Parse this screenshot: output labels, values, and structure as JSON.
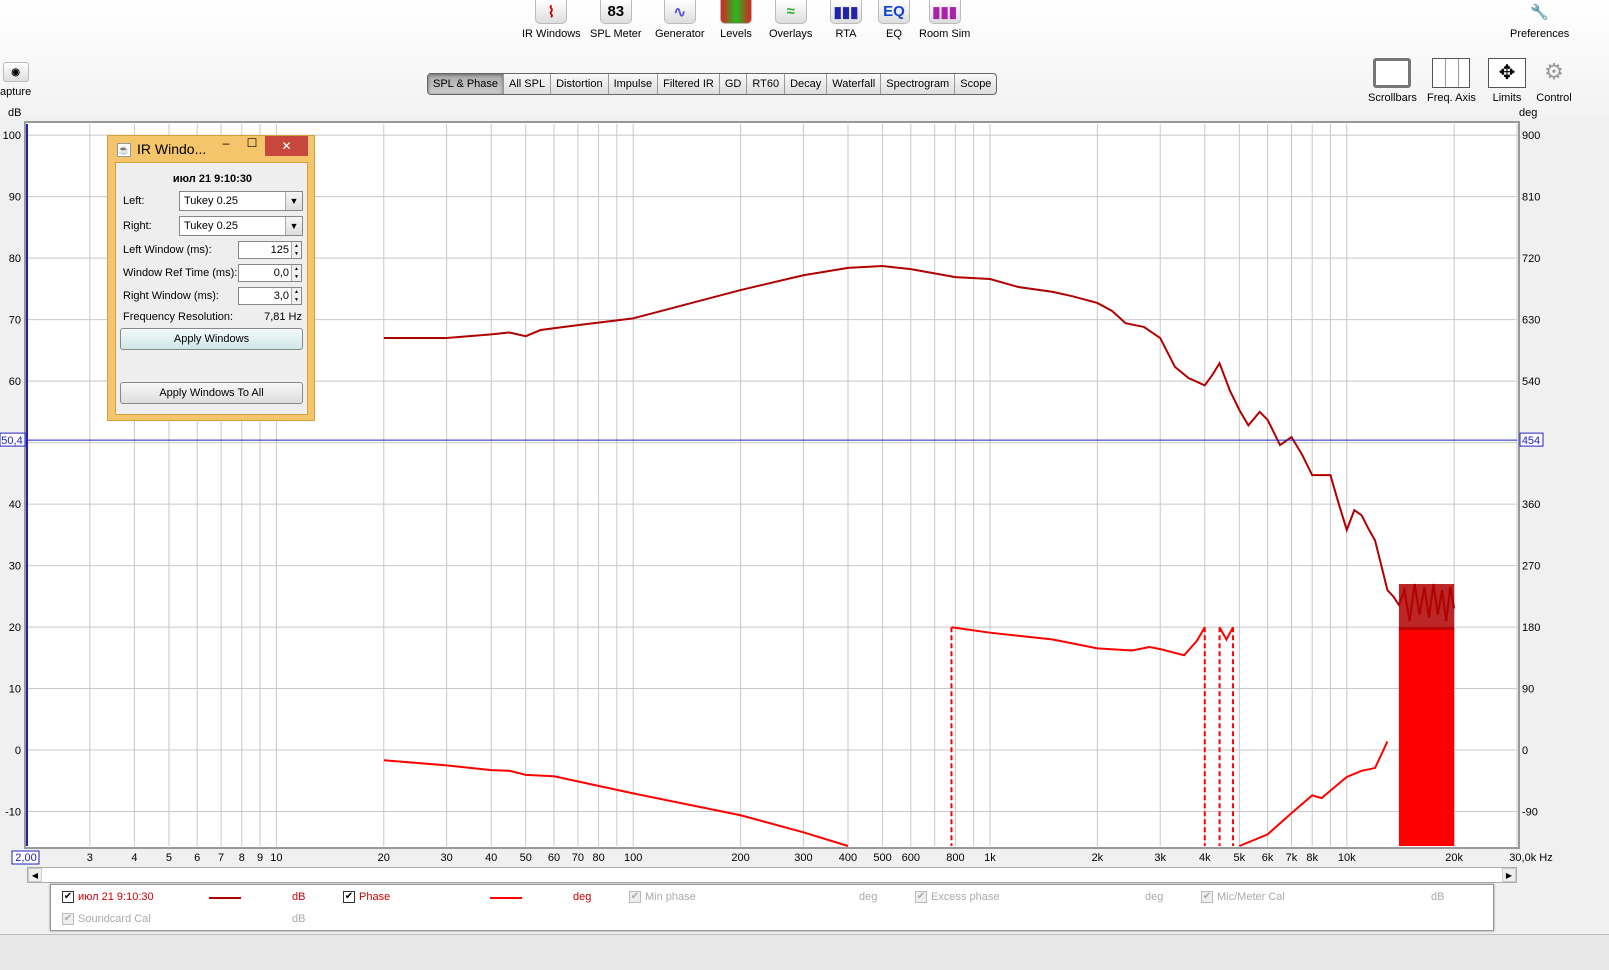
{
  "toolbar": {
    "tools": [
      {
        "label": "IR Windows",
        "icon": "ir-windows-icon"
      },
      {
        "label": "SPL Meter",
        "icon": "spl-meter-icon",
        "value": "83"
      },
      {
        "label": "Generator",
        "icon": "generator-icon"
      },
      {
        "label": "Levels",
        "icon": "levels-icon"
      },
      {
        "label": "Overlays",
        "icon": "overlays-icon"
      },
      {
        "label": "RTA",
        "icon": "rta-icon"
      },
      {
        "label": "EQ",
        "icon": "eq-icon",
        "value": "EQ"
      },
      {
        "label": "Room Sim",
        "icon": "room-sim-icon"
      }
    ],
    "preferences": "Preferences",
    "capture": "apture"
  },
  "tabs": [
    "SPL & Phase",
    "All SPL",
    "Distortion",
    "Impulse",
    "Filtered IR",
    "GD",
    "RT60",
    "Decay",
    "Waterfall",
    "Spectrogram",
    "Scope"
  ],
  "active_tab": "SPL & Phase",
  "right_tools": [
    "Scrollbars",
    "Freq. Axis",
    "Limits",
    "Control"
  ],
  "colors": {
    "spl": "#b00000",
    "phase": "#ff0000",
    "cursor": "#2020c0",
    "grid": "#c8c8c8"
  },
  "chart_data": {
    "type": "line",
    "xscale": "log",
    "xlim": [
      2,
      30000
    ],
    "ylim": [
      -15.6,
      101.8
    ],
    "y2lim": [
      -140,
      916
    ],
    "ylabel": "dB",
    "y2label": "deg",
    "xunit": "Hz",
    "yticks": [
      100,
      90,
      80,
      70,
      60,
      50,
      40,
      30,
      20,
      10,
      0,
      -10
    ],
    "y2ticks": [
      "900",
      "810",
      "720",
      "630",
      "540",
      "",
      "360",
      "270",
      "180",
      "90",
      "0",
      "-90"
    ],
    "xticks": [
      {
        "v": 3,
        "t": "3"
      },
      {
        "v": 4,
        "t": "4"
      },
      {
        "v": 5,
        "t": "5"
      },
      {
        "v": 6,
        "t": "6"
      },
      {
        "v": 7,
        "t": "7"
      },
      {
        "v": 8,
        "t": "8"
      },
      {
        "v": 9,
        "t": "9"
      },
      {
        "v": 10,
        "t": "10"
      },
      {
        "v": 20,
        "t": "20"
      },
      {
        "v": 30,
        "t": "30"
      },
      {
        "v": 40,
        "t": "40"
      },
      {
        "v": 50,
        "t": "50"
      },
      {
        "v": 60,
        "t": "60"
      },
      {
        "v": 70,
        "t": "70"
      },
      {
        "v": 80,
        "t": "80"
      },
      {
        "v": 100,
        "t": "100"
      },
      {
        "v": 200,
        "t": "200"
      },
      {
        "v": 300,
        "t": "300"
      },
      {
        "v": 400,
        "t": "400"
      },
      {
        "v": 500,
        "t": "500"
      },
      {
        "v": 600,
        "t": "600"
      },
      {
        "v": 800,
        "t": "800"
      },
      {
        "v": 1000,
        "t": "1k"
      },
      {
        "v": 2000,
        "t": "2k"
      },
      {
        "v": 3000,
        "t": "3k"
      },
      {
        "v": 4000,
        "t": "4k"
      },
      {
        "v": 5000,
        "t": "5k"
      },
      {
        "v": 6000,
        "t": "6k"
      },
      {
        "v": 7000,
        "t": "7k"
      },
      {
        "v": 8000,
        "t": "8k"
      },
      {
        "v": 10000,
        "t": "10k"
      },
      {
        "v": 20000,
        "t": "20k"
      },
      {
        "v": 30000,
        "t": "30,0k Hz"
      }
    ],
    "x_start_label": "2,00",
    "cursor": {
      "db": 50.4,
      "db_label": "50,4",
      "deg_label": "454"
    },
    "series": [
      {
        "name": "июл 21 9:10:30",
        "unit": "dB",
        "points": [
          [
            20,
            67
          ],
          [
            30,
            67
          ],
          [
            40,
            67.6
          ],
          [
            45,
            67.9
          ],
          [
            50,
            67.3
          ],
          [
            55,
            68.3
          ],
          [
            70,
            69.1
          ],
          [
            100,
            70.2
          ],
          [
            200,
            74.8
          ],
          [
            300,
            77.2
          ],
          [
            400,
            78.4
          ],
          [
            500,
            78.7
          ],
          [
            600,
            78.2
          ],
          [
            800,
            76.9
          ],
          [
            1000,
            76.6
          ],
          [
            1200,
            75.3
          ],
          [
            1500,
            74.5
          ],
          [
            1700,
            73.8
          ],
          [
            2000,
            72.7
          ],
          [
            2200,
            71.4
          ],
          [
            2400,
            69.4
          ],
          [
            2700,
            68.8
          ],
          [
            3000,
            67
          ],
          [
            3300,
            62.3
          ],
          [
            3600,
            60.5
          ],
          [
            4000,
            59.3
          ],
          [
            4200,
            61
          ],
          [
            4400,
            62.9
          ],
          [
            4700,
            58.5
          ],
          [
            5000,
            55.3
          ],
          [
            5300,
            52.8
          ],
          [
            5700,
            55
          ],
          [
            6000,
            53.7
          ],
          [
            6500,
            49.6
          ],
          [
            7000,
            50.9
          ],
          [
            7500,
            48
          ],
          [
            8000,
            44.7
          ],
          [
            9000,
            44.7
          ],
          [
            9500,
            40
          ],
          [
            10000,
            35.8
          ],
          [
            10500,
            39
          ],
          [
            11000,
            38.2
          ],
          [
            11500,
            36
          ],
          [
            12000,
            34.1
          ],
          [
            12500,
            30
          ],
          [
            13000,
            26
          ],
          [
            13500,
            25
          ],
          [
            14000,
            23.6
          ],
          [
            14500,
            26
          ],
          [
            15000,
            21
          ],
          [
            15500,
            27
          ],
          [
            16000,
            22
          ],
          [
            16500,
            26.5
          ],
          [
            17000,
            21.5
          ],
          [
            17500,
            27
          ],
          [
            18000,
            22
          ],
          [
            18500,
            26
          ],
          [
            19000,
            21
          ],
          [
            19500,
            26.5
          ],
          [
            20000,
            23
          ]
        ]
      },
      {
        "name": "Phase",
        "unit": "deg",
        "segments": [
          [
            [
              20,
              -14.6
            ],
            [
              30,
              -22
            ],
            [
              40,
              -29
            ],
            [
              45,
              -30
            ],
            [
              50,
              -36
            ],
            [
              60,
              -38
            ],
            [
              100,
              -63
            ],
            [
              200,
              -95
            ],
            [
              300,
              -120
            ],
            [
              400,
              -140
            ]
          ],
          [
            [
              780,
              180
            ],
            [
              1000,
              172
            ],
            [
              1500,
              162
            ],
            [
              2000,
              149
            ],
            [
              2500,
              146
            ],
            [
              2800,
              151
            ],
            [
              3000,
              148
            ],
            [
              3500,
              139
            ],
            [
              3800,
              160
            ],
            [
              4000,
              180
            ]
          ],
          [
            [
              4400,
              180
            ],
            [
              4600,
              162
            ],
            [
              4800,
              180
            ]
          ],
          [
            [
              5000,
              -140
            ],
            [
              6000,
              -123
            ],
            [
              7000,
              -92
            ],
            [
              8000,
              -66
            ],
            [
              8500,
              -70
            ],
            [
              9000,
              -59
            ],
            [
              10000,
              -39
            ],
            [
              11000,
              -30
            ],
            [
              12000,
              -26
            ],
            [
              13000,
              13
            ]
          ]
        ],
        "wraps": [
          780,
          4000,
          4400,
          4800
        ],
        "noise_band": {
          "from": 14000,
          "to": 20000,
          "min": -140,
          "max": 180
        }
      }
    ]
  },
  "legend": [
    {
      "label": "июл 21 9:10:30",
      "unit": "dB",
      "checked": true,
      "enabled": true,
      "color": "#b00000"
    },
    {
      "label": "Phase",
      "unit": "deg",
      "checked": true,
      "enabled": true,
      "color": "#ff0000"
    },
    {
      "label": "Min phase",
      "unit": "deg",
      "checked": true,
      "enabled": false
    },
    {
      "label": "Excess phase",
      "unit": "deg",
      "checked": true,
      "enabled": false
    },
    {
      "label": "Mic/Meter Cal",
      "unit": "dB",
      "checked": true,
      "enabled": false
    },
    {
      "label": "Soundcard Cal",
      "unit": "dB",
      "checked": true,
      "enabled": false
    }
  ],
  "dialog": {
    "title": "IR Windo...",
    "measurement": "июл 21 9:10:30",
    "left_label": "Left:",
    "left_value": "Tukey 0.25",
    "right_label": "Right:",
    "right_value": "Tukey 0.25",
    "left_window_label": "Left Window (ms):",
    "left_window": "125",
    "ref_time_label": "Window Ref Time (ms):",
    "ref_time": "0,0",
    "right_window_label": "Right Window (ms):",
    "right_window": "3,0",
    "freq_res_label": "Frequency Resolution:",
    "freq_res": "7,81 Hz",
    "apply": "Apply Windows",
    "apply_all": "Apply Windows To All",
    "minimize": "–",
    "maximize": "☐",
    "close": "✕"
  }
}
